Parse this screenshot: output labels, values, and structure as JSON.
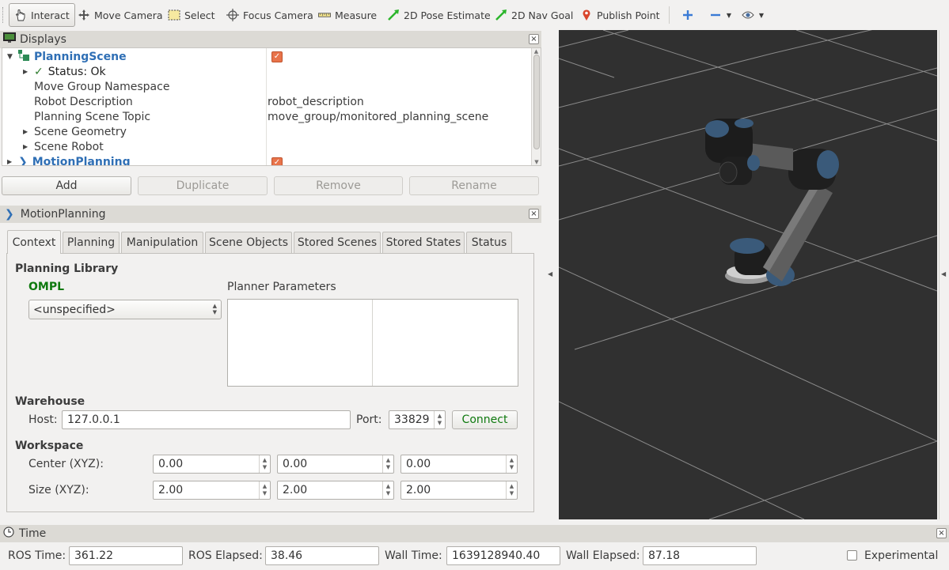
{
  "toolbar": {
    "items": [
      {
        "label": "Interact",
        "icon": "hand-icon"
      },
      {
        "label": "Move Camera",
        "icon": "move-camera-icon"
      },
      {
        "label": "Select",
        "icon": "select-icon"
      },
      {
        "label": "Focus Camera",
        "icon": "focus-camera-icon"
      },
      {
        "label": "Measure",
        "icon": "ruler-icon"
      },
      {
        "label": "2D Pose Estimate",
        "icon": "pose-arrow-icon"
      },
      {
        "label": "2D Nav Goal",
        "icon": "nav-arrow-icon"
      },
      {
        "label": "Publish Point",
        "icon": "pin-icon"
      }
    ]
  },
  "displays": {
    "title": "Displays",
    "tree": {
      "planning_scene": "PlanningScene",
      "status": "Status: Ok",
      "move_group_ns": "Move Group Namespace",
      "robot_description_label": "Robot Description",
      "robot_description_value": "robot_description",
      "planning_scene_topic_label": "Planning Scene Topic",
      "planning_scene_topic_value": "move_group/monitored_planning_scene",
      "scene_geometry": "Scene Geometry",
      "scene_robot": "Scene Robot",
      "motion_planning": "MotionPlanning"
    },
    "buttons": {
      "add": "Add",
      "duplicate": "Duplicate",
      "remove": "Remove",
      "rename": "Rename"
    }
  },
  "motion_panel": {
    "title": "MotionPlanning",
    "tabs": [
      "Context",
      "Planning",
      "Manipulation",
      "Scene Objects",
      "Stored Scenes",
      "Stored States",
      "Status"
    ],
    "planning_library_label": "Planning Library",
    "library_name": "OMPL",
    "planner_select": "<unspecified>",
    "planner_params_label": "Planner Parameters",
    "warehouse_label": "Warehouse",
    "host_label": "Host:",
    "host_value": "127.0.0.1",
    "port_label": "Port:",
    "port_value": "33829",
    "connect_label": "Connect",
    "workspace_label": "Workspace",
    "center_label": "Center (XYZ):",
    "center_values": [
      "0.00",
      "0.00",
      "0.00"
    ],
    "size_label": "Size (XYZ):",
    "size_values": [
      "2.00",
      "2.00",
      "2.00"
    ]
  },
  "time": {
    "title": "Time",
    "ros_time_label": "ROS Time:",
    "ros_time_value": "361.22",
    "ros_elapsed_label": "ROS Elapsed:",
    "ros_elapsed_value": "38.46",
    "wall_time_label": "Wall Time:",
    "wall_time_value": "1639128940.40",
    "wall_elapsed_label": "Wall Elapsed:",
    "wall_elapsed_value": "87.18",
    "experimental_label": "Experimental"
  },
  "colors": {
    "accent_blue": "#2f6fb5",
    "ompl_green": "#0f7a0f",
    "viewport_bg": "#303030",
    "checkbox_orange": "#e8734a"
  }
}
